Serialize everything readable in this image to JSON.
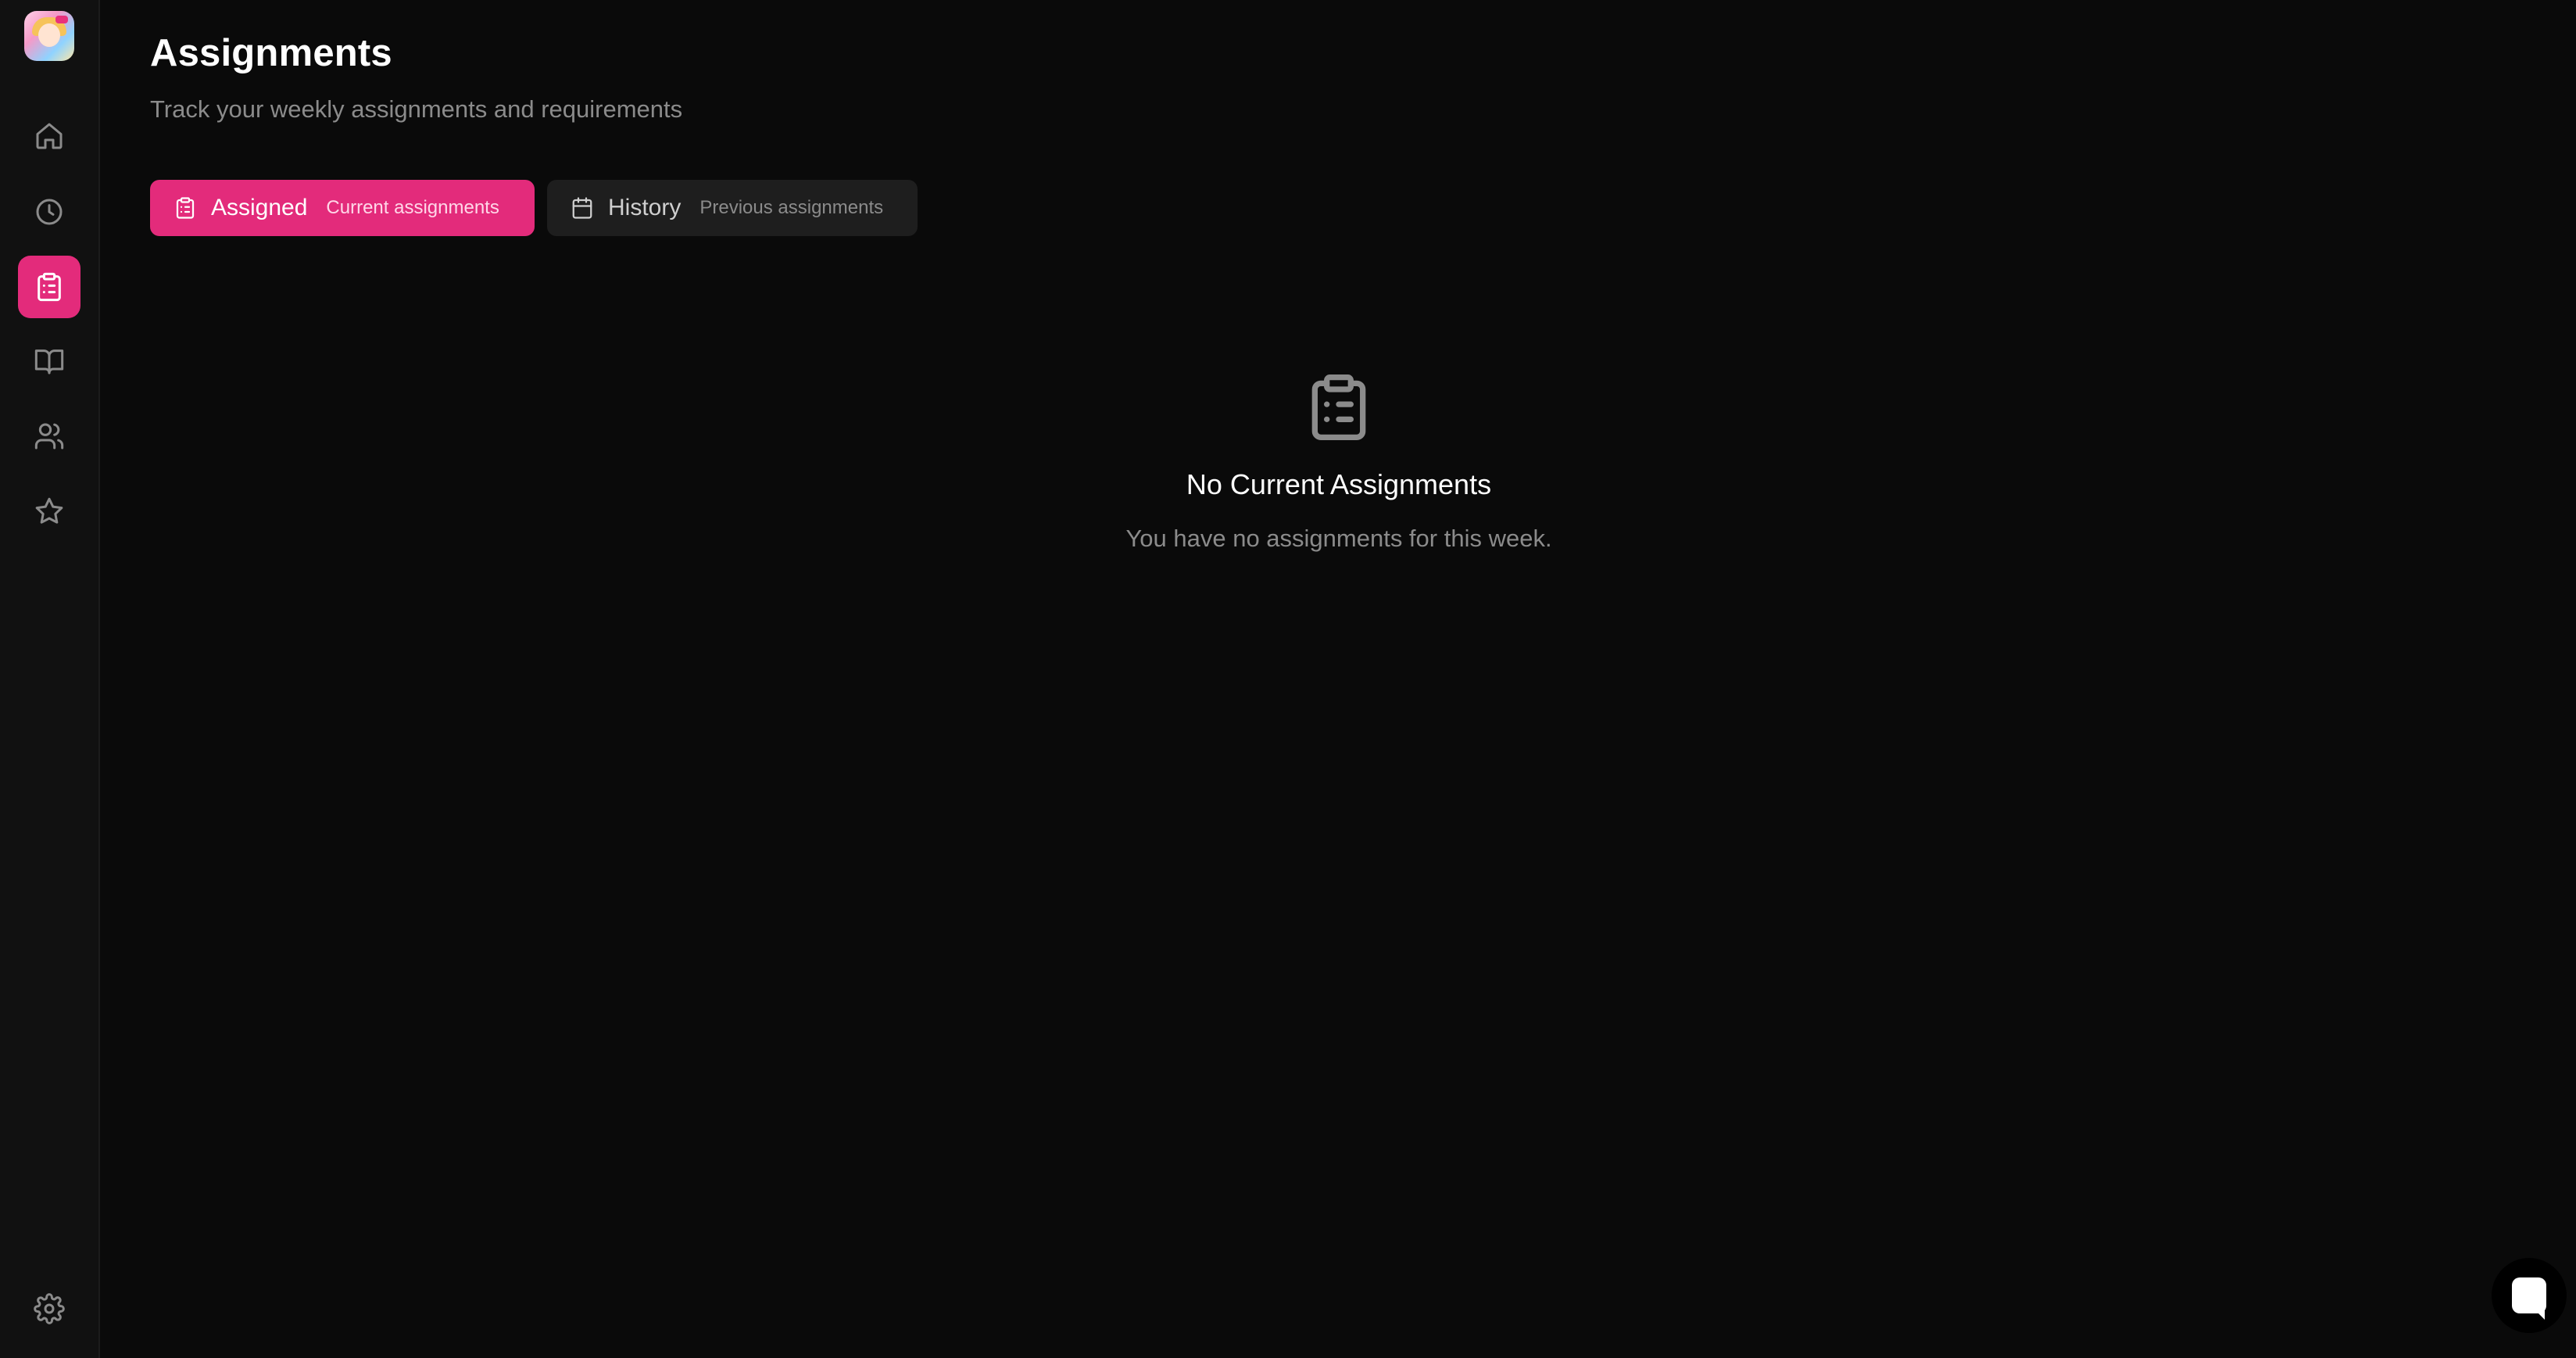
{
  "sidebar": {
    "logo_icon": "app-logo-avatar",
    "items": [
      {
        "name": "home",
        "icon": "home-icon",
        "active": false
      },
      {
        "name": "history",
        "icon": "clock-icon",
        "active": false
      },
      {
        "name": "assignments",
        "icon": "clipboard-list-icon",
        "active": true
      },
      {
        "name": "library",
        "icon": "book-open-icon",
        "active": false
      },
      {
        "name": "users",
        "icon": "users-icon",
        "active": false
      },
      {
        "name": "favorites",
        "icon": "star-icon",
        "active": false
      }
    ],
    "settings_icon": "gear-icon"
  },
  "header": {
    "title": "Assignments",
    "subtitle": "Track your weekly assignments and requirements"
  },
  "tabs": [
    {
      "label": "Assigned",
      "description": "Current assignments",
      "icon": "clipboard-list-icon",
      "active": true
    },
    {
      "label": "History",
      "description": "Previous assignments",
      "icon": "calendar-icon",
      "active": false
    }
  ],
  "empty_state": {
    "icon": "clipboard-list-icon",
    "title": "No Current Assignments",
    "message": "You have no assignments for this week."
  },
  "chat": {
    "icon": "chat-bubble-icon"
  },
  "colors": {
    "accent": "#e32b7b",
    "background": "#0a0a0a",
    "sidebar": "#111111",
    "muted_text": "#8b8b8b",
    "inactive_tab": "#1e1e1e"
  }
}
